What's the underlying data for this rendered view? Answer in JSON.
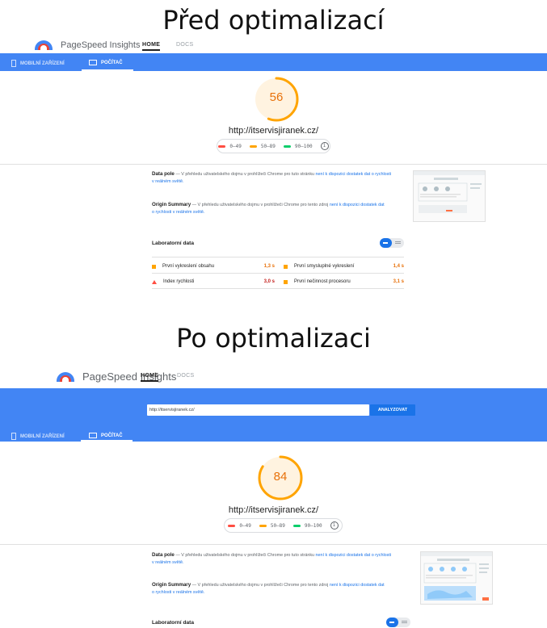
{
  "colors": {
    "accent_blue": "#4285f4",
    "orange": "#ffa400",
    "red": "#ff4e42",
    "green": "#0cce6b"
  },
  "before": {
    "heading": "Před optimalizací",
    "brand": "PageSpeed Insights",
    "nav": {
      "home": "HOME",
      "docs": "DOCS"
    },
    "device_tabs": {
      "mobile": "MOBILNÍ ZAŘÍZENÍ",
      "desktop": "POČÍTAČ"
    },
    "score": 56,
    "url": "http://itservisjiranek.cz/",
    "legend": {
      "red": "0–49",
      "orange": "50–89",
      "green": "90–100",
      "info_icon": "info-icon"
    },
    "field_data": {
      "title": "Data pole",
      "text": "— V přehledu uživatelského dojmu v prohlížeči Chrome pro tuto stránku",
      "link": "není k dispozici dostatek dat o rychlosti v reálném světě."
    },
    "origin_summary": {
      "title": "Origin Summary",
      "text": "— V přehledu uživatelského dojmu v prohlížeči Chrome pro tento zdroj",
      "link": "není k dispozici dostatek dat o rychlosti v reálném světě."
    },
    "lab": {
      "title": "Laboratorní data",
      "metrics": [
        {
          "label": "První vykreslení obsahu",
          "value": "1,3 s"
        },
        {
          "label": "První smysluplné vykreslení",
          "value": "1,4 s"
        },
        {
          "label": "Index rychlosti",
          "value": "3,0 s"
        },
        {
          "label": "První nečinnost procesoru",
          "value": "3,1 s"
        }
      ]
    }
  },
  "after": {
    "heading": "Po optimalizaci",
    "brand": "PageSpeed Insights",
    "nav": {
      "home": "HOME",
      "docs": "DOCS"
    },
    "search_value": "http://itservisjiranek.cz/",
    "analyze_label": "ANALYZOVAT",
    "device_tabs": {
      "mobile": "MOBILNÍ ZAŘÍZENÍ",
      "desktop": "POČÍTAČ"
    },
    "score": 84,
    "url": "http://itservisjiranek.cz/",
    "legend": {
      "red": "0–49",
      "orange": "50–89",
      "green": "90–100",
      "info_icon": "info-icon"
    },
    "field_data": {
      "title": "Data pole",
      "text": "— V přehledu uživatelského dojmu v prohlížeči Chrome pro tuto stránku",
      "link": "není k dispozici dostatek dat o rychlosti v reálném světě."
    },
    "origin_summary": {
      "title": "Origin Summary",
      "text": "— V přehledu uživatelského dojmu v prohlížeči Chrome pro tento zdroj",
      "link": "není k dispozici dostatek dat o rychlosti v reálném světě."
    },
    "lab": {
      "title": "Laboratorní data"
    }
  }
}
